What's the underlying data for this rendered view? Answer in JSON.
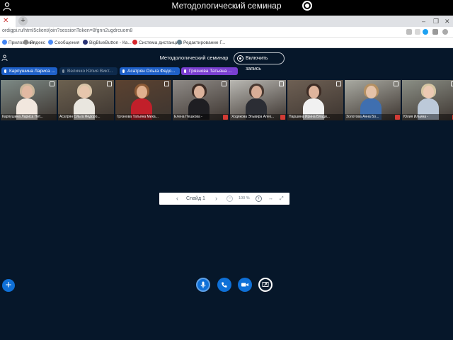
{
  "os_bar": {
    "title": "Методологический семинар",
    "user_icon": "user-icon",
    "record_icon": "radio-record-icon"
  },
  "browser": {
    "tab_close_icon": "close-icon",
    "new_tab_label": "+",
    "url": "ordigpi.ru/html5client/join?sessionToken=8fgnn2ugdrcuom8",
    "bookmarks": [
      {
        "label": "Приложения",
        "color": "#4285f4"
      },
      {
        "label": "Яндекс",
        "color": "#888888"
      },
      {
        "label": "Сообщения",
        "color": "#4c8bf5"
      },
      {
        "label": "BigBlueButton - Ка...",
        "color": "#283274"
      },
      {
        "label": "Система дистанци...",
        "color": "#d7262c"
      },
      {
        "label": "Редактирование Г...",
        "color": "#607d8b"
      }
    ]
  },
  "app": {
    "meeting_title": "Методологический семинар",
    "record_label": "Включить запись",
    "talkers": [
      {
        "name": "Карпушина Лариса ...",
        "bg": "#1e60c8",
        "color": "#ffffff"
      },
      {
        "name": "Величко Юлия Викт...",
        "bg": "#0d2a4c",
        "color": "#9aa9b8"
      },
      {
        "name": "Асатрян Ольга Федо...",
        "bg": "#1e60c8",
        "color": "#ffffff"
      },
      {
        "name": "Грязнова Татьяна ...",
        "bg": "#7a3fd1",
        "color": "#ffffff"
      }
    ],
    "videos": [
      {
        "name": "Карпушина Лариса Пет...",
        "bg": "#7d8a86",
        "skin": "#e2b9a2",
        "hair": "#cbb69a",
        "shirt": "#f1e7de",
        "muted": false
      },
      {
        "name": "Асатрян Ольга Федоро...",
        "bg": "#6c6150",
        "skin": "#e7c6ad",
        "hair": "#d8c4a7",
        "shirt": "#e9e6df",
        "muted": false
      },
      {
        "name": "Грязнова Татьяна Миха...",
        "bg": "#5b4230",
        "skin": "#e0b08e",
        "hair": "#8c5a36",
        "shirt": "#c21f2a",
        "muted": false
      },
      {
        "name": "Елена Пешкова -",
        "bg": "#8f8b87",
        "skin": "#dcb39c",
        "hair": "#3b2a23",
        "shirt": "#1e1e22",
        "muted": true
      },
      {
        "name": "Ходякова Эльвира Алек...",
        "bg": "#b9b8b3",
        "skin": "#d9ae97",
        "hair": "#4a3a32",
        "shirt": "#2b2d34",
        "muted": true
      },
      {
        "name": "Паршина Ирина Влади...",
        "bg": "#6e6054",
        "skin": "#dfb49c",
        "hair": "#3c2b24",
        "shirt": "#f1f1f1",
        "muted": false
      },
      {
        "name": "Золотова Анна Бо...",
        "bg": "#a9aaa2",
        "skin": "#e5c2a8",
        "hair": "#b49063",
        "shirt": "#3f6fb0",
        "muted": true
      },
      {
        "name": "Юлия Ильина -",
        "bg": "#8b8f86",
        "skin": "#ecc9b3",
        "hair": "#d5c5a2",
        "shirt": "#bcc9d9",
        "muted": true
      }
    ],
    "slide_controls": {
      "prev_icon": "chevron-left-icon",
      "slide_label": "Слайд 1",
      "next_icon": "chevron-right-icon",
      "zoom_out": "−",
      "zoom_value": "100 %",
      "zoom_in": "+",
      "fit_width_icon": "fit-width-icon",
      "fullscreen_icon": "fullscreen-icon"
    },
    "actions_label": "+",
    "controls": {
      "audio_icon": "microphone-icon",
      "phone_icon": "phone-icon",
      "video_icon": "camera-icon",
      "share_icon": "screen-share-icon"
    }
  }
}
